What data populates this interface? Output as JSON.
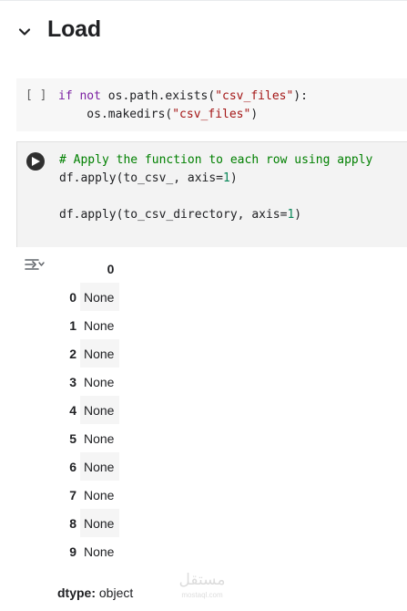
{
  "section": {
    "title": "Load",
    "toggle_icon": "chevron-down-icon"
  },
  "cells": [
    {
      "execution_count": "[ ]",
      "lines": [
        [
          {
            "t": "if",
            "c": "kw"
          },
          {
            "t": " "
          },
          {
            "t": "not",
            "c": "kw"
          },
          {
            "t": " os.path.exists("
          },
          {
            "t": "\"csv_files\"",
            "c": "str"
          },
          {
            "t": "):"
          }
        ],
        [
          {
            "t": "    os.makedirs("
          },
          {
            "t": "\"csv_files\"",
            "c": "str"
          },
          {
            "t": ")"
          }
        ]
      ]
    },
    {
      "run_icon": "play-icon",
      "lines": [
        [
          {
            "t": "# Apply the function to each row using apply",
            "c": "cmt"
          }
        ],
        [
          {
            "t": "df.apply(to_csv_, axis="
          },
          {
            "t": "1",
            "c": "num"
          },
          {
            "t": ")"
          }
        ],
        [
          {
            "t": ""
          }
        ],
        [
          {
            "t": "df.apply(to_csv_directory, axis="
          },
          {
            "t": "1",
            "c": "num"
          },
          {
            "t": ")"
          }
        ]
      ]
    }
  ],
  "output": {
    "icon": "output-actions-icon",
    "table": {
      "column_header": "0",
      "rows": [
        {
          "index": "0",
          "value": "None"
        },
        {
          "index": "1",
          "value": "None"
        },
        {
          "index": "2",
          "value": "None"
        },
        {
          "index": "3",
          "value": "None"
        },
        {
          "index": "4",
          "value": "None"
        },
        {
          "index": "5",
          "value": "None"
        },
        {
          "index": "6",
          "value": "None"
        },
        {
          "index": "7",
          "value": "None"
        },
        {
          "index": "8",
          "value": "None"
        },
        {
          "index": "9",
          "value": "None"
        }
      ]
    },
    "dtype_label": "dtype:",
    "dtype_value": "object"
  },
  "watermark": {
    "main": "مستقل",
    "sub": "mostaql.com"
  }
}
